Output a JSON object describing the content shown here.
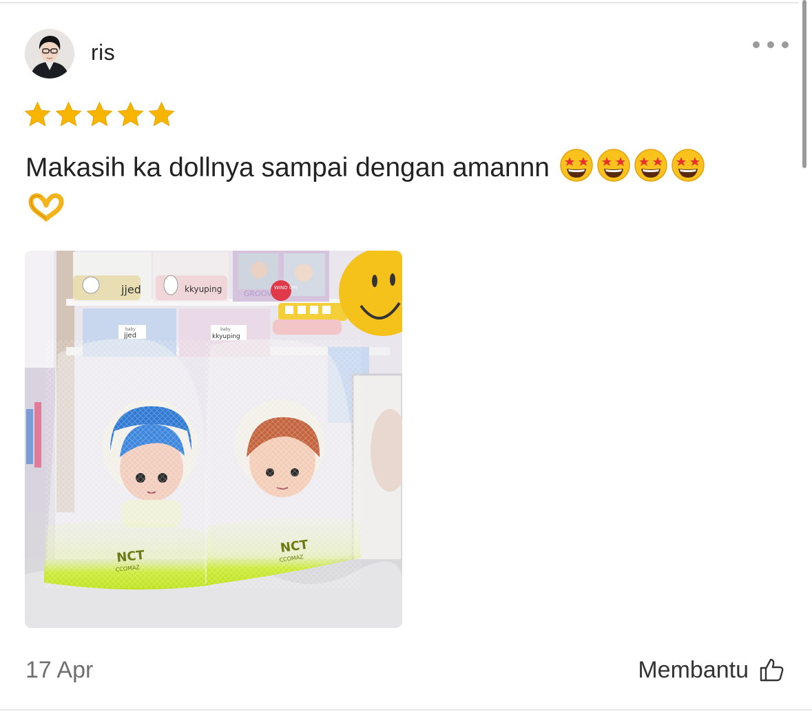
{
  "review": {
    "username": "ris",
    "rating": 5,
    "text": "Makasih ka dollnya sampai dengan amannn",
    "emojis": [
      "star-struck-emoji",
      "star-struck-emoji",
      "star-struck-emoji",
      "star-struck-emoji",
      "heart-hands-emoji"
    ],
    "date": "17 Apr",
    "helpful_label": "Membantu"
  },
  "photo": {
    "labels": {
      "box1": "jjed",
      "box2": "kkyuping",
      "box3_top": "baby",
      "box3": "jjed",
      "box4_top": "baby",
      "box4": "kkyuping",
      "badge": "WIND UP!",
      "bag_brand": "NCT",
      "bag_sub": "CCOMAZ",
      "frame_text": "GROOV"
    }
  },
  "colors": {
    "star": "#f7b500",
    "accent_green": "#c7ea2a",
    "muted": "#9b9b9b"
  }
}
